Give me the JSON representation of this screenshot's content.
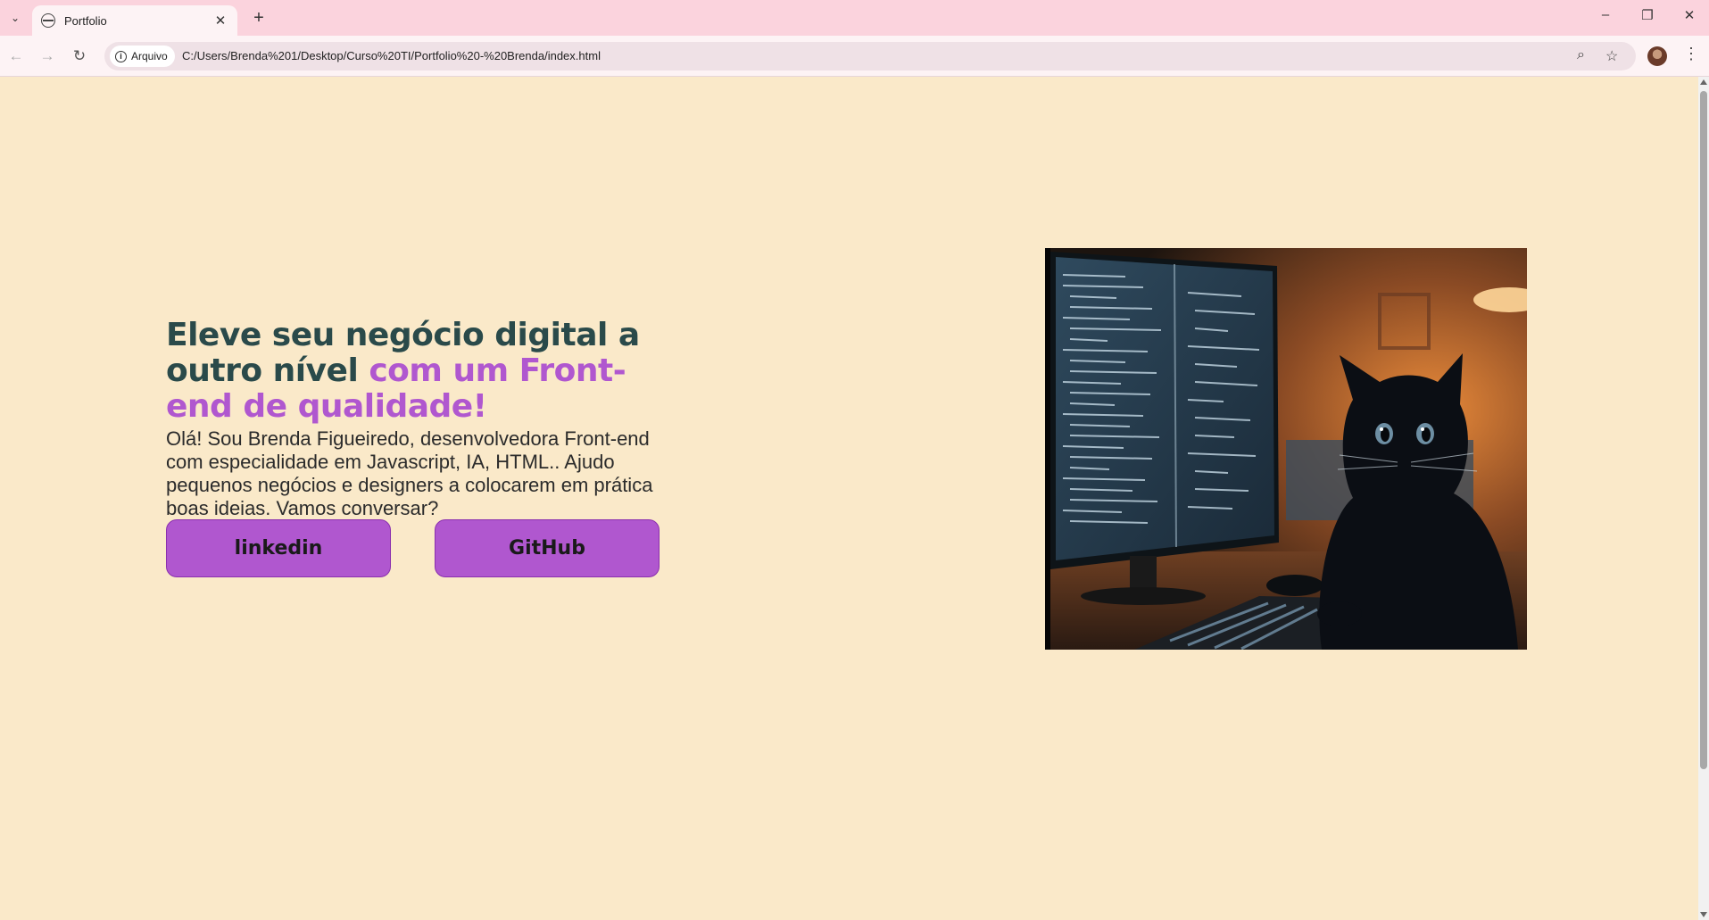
{
  "browser": {
    "tab_title": "Portfolio",
    "site_info_label": "Arquivo",
    "url": "C:/Users/Brenda%201/Desktop/Curso%20TI/Portfolio%20-%20Brenda/index.html"
  },
  "icons": {
    "tab_list": "chevron-down-icon",
    "favicon": "globe-icon",
    "tab_close": "close-icon",
    "new_tab": "plus-icon",
    "minimize": "minimize-icon",
    "restore": "restore-icon",
    "close_window": "close-icon",
    "back": "arrow-left-icon",
    "forward": "arrow-right-icon",
    "reload": "reload-icon",
    "info": "info-icon",
    "zoom": "zoom-icon",
    "bookmark": "star-icon",
    "menu": "more-vert-icon"
  },
  "hero": {
    "headline_part1": "Eleve seu negócio digital a outro nível ",
    "headline_part2": "com um Front-end de qualidade!",
    "intro": "Olá! Sou Brenda Figueiredo, desenvolvedora Front-end com especialidade em Javascript, IA, HTML.. Ajudo pequenos negócios e designers a colocarem em prática boas ideias. Vamos conversar?",
    "accent_color": "#b057cf",
    "heading_color": "#2a4a4a",
    "background_color": "#fae9c9"
  },
  "buttons": {
    "linkedin": "linkedin",
    "github": "GitHub"
  }
}
